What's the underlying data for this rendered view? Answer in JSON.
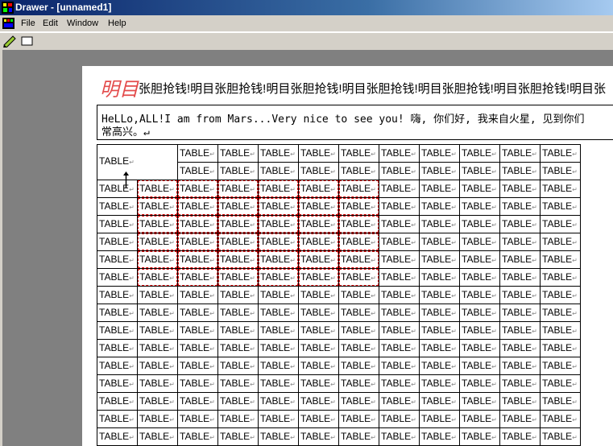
{
  "window": {
    "title": "Drawer - [unnamed1]"
  },
  "menu": {
    "file": "File",
    "edit": "Edit",
    "window": "Window",
    "help": "Help"
  },
  "toolbar": {
    "icons": [
      "pen-icon",
      "rectangle-icon"
    ]
  },
  "document": {
    "banner_big": "明目",
    "banner_rest": "张胆抢钱!明目张胆抢钱!明目张胆抢钱!明目张胆抢钱!明目张胆抢钱!明目张胆抢钱!明目张",
    "textbox_line1": "HeLLo,ALL!I am from Mars...Very nice to see you! 嗨, 你们好, 我来自火星, 见到你们",
    "textbox_line2": "常高兴。↵",
    "table": {
      "cell_text": "TABLE",
      "paragraph_mark": "↵",
      "corner_text": "TABLE",
      "rows": 17,
      "cols": 12,
      "colors": {
        "selection": "#e00000"
      }
    }
  }
}
